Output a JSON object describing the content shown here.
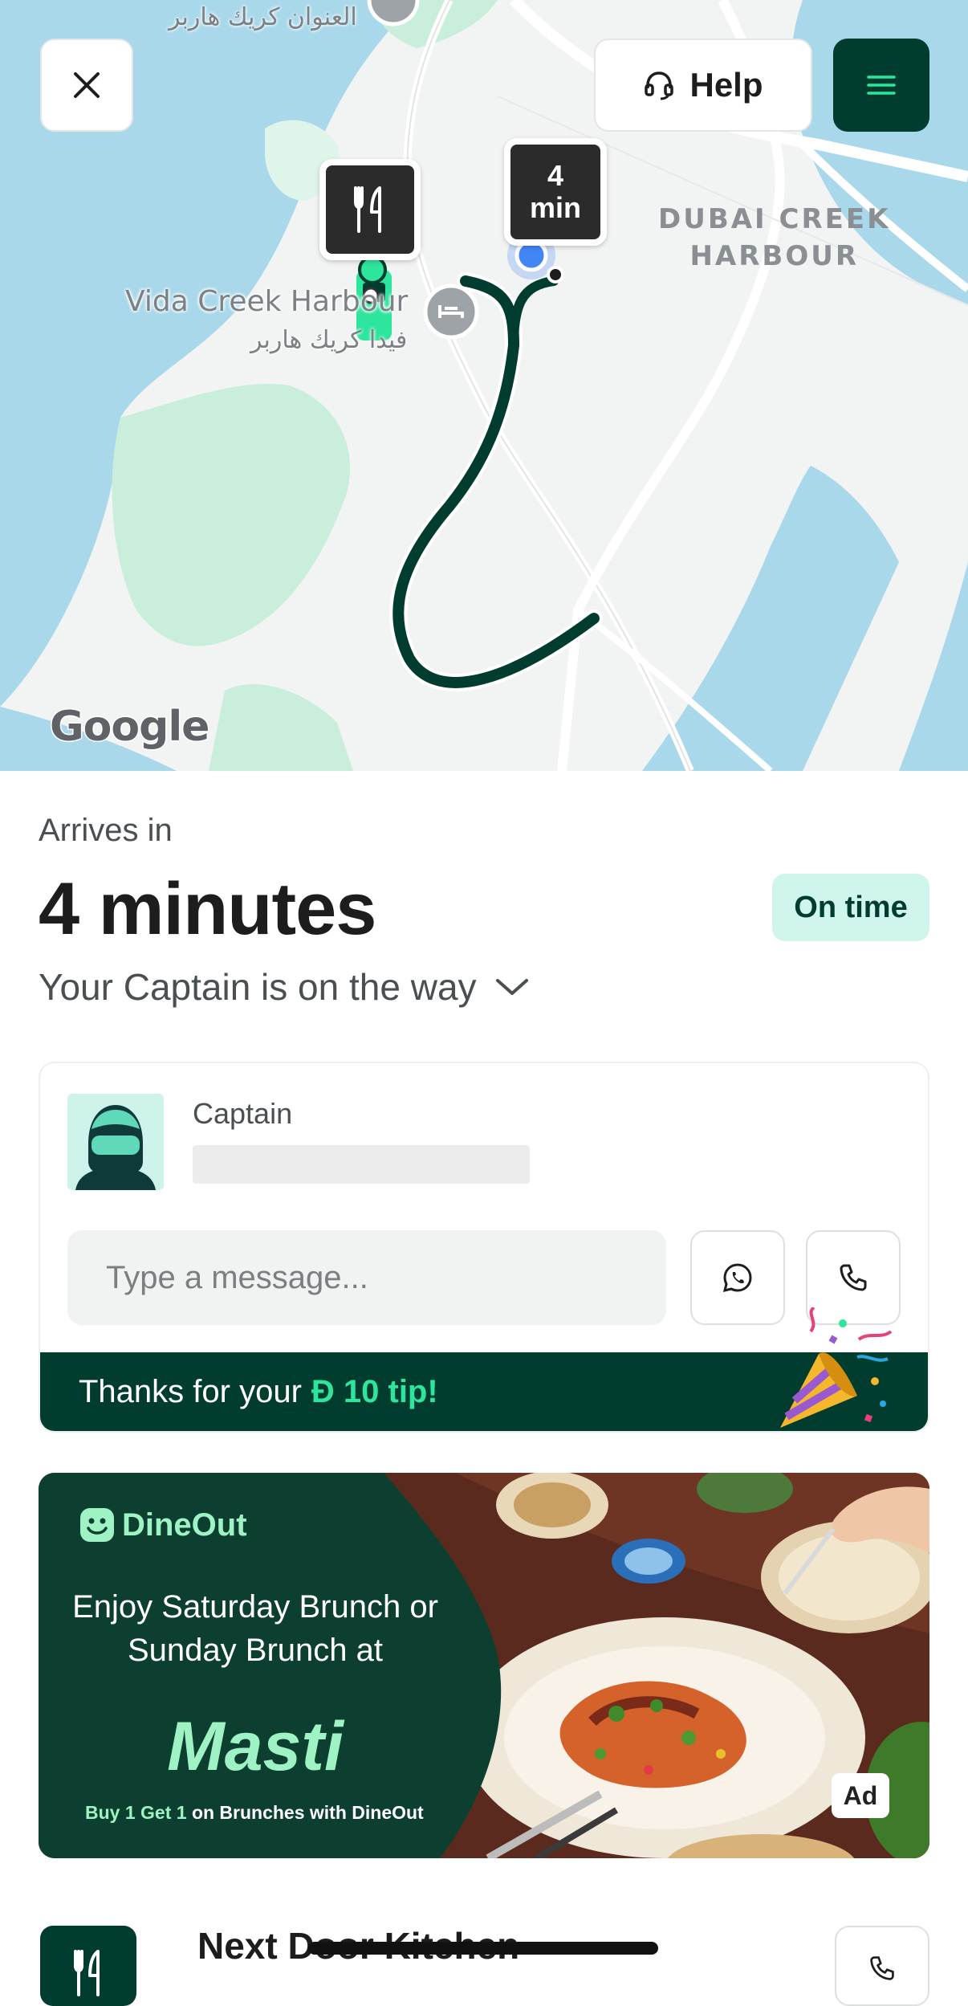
{
  "map": {
    "area_label_line1": "DUBAI CREEK",
    "area_label_line2": "HARBOUR",
    "place_name": "Vida Creek Harbour",
    "place_name_arabic": "فيدا كريك هاربر",
    "top_arabic_label": "العنوان كريك هاربر",
    "google_logo": "Google",
    "eta_pin_value": "4",
    "eta_pin_unit": "min",
    "restaurant_pin_icon": "fork-knife-icon",
    "hotel_pin_icon": "bed-icon"
  },
  "header": {
    "close_icon": "close-icon",
    "help_label": "Help",
    "help_icon": "headset-icon",
    "menu_icon": "hamburger-menu-icon"
  },
  "status": {
    "arrives_label": "Arrives in",
    "eta": "4 minutes",
    "badge": "On time",
    "message": "Your Captain is on the way"
  },
  "captain": {
    "label": "Captain",
    "message_placeholder": "Type a message...",
    "whatsapp_icon": "whatsapp-icon",
    "call_icon": "phone-icon"
  },
  "tip": {
    "prefix": "Thanks for your",
    "amount": "Ð 10 tip!"
  },
  "ad": {
    "brand": "DineOut",
    "headline": "Enjoy Saturday Brunch or Sunday Brunch at",
    "restaurant": "Masti",
    "offer_highlight": "Buy 1 Get 1",
    "offer_rest": "on Brunches with DineOut",
    "badge": "Ad"
  },
  "next_item": {
    "name": "Next Door Kitchen"
  },
  "colors": {
    "brand_dark": "#003d2f",
    "accent_green": "#2ee59d",
    "on_time_bg": "#cff5ec",
    "water": "#a8d8ea",
    "park": "#c9eedc",
    "route": "#003d2f"
  }
}
